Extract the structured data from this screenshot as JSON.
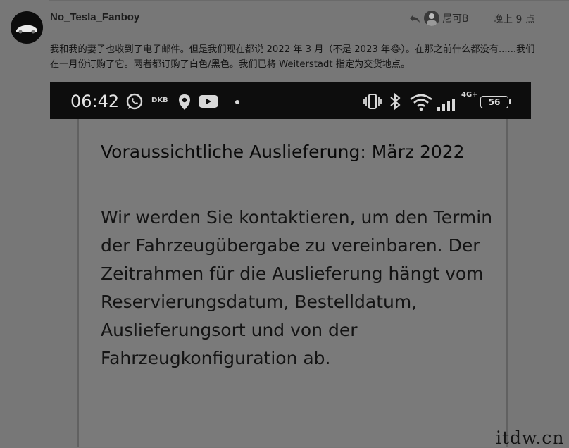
{
  "post": {
    "username": "No_Tesla_Fanboy",
    "reply_to_user": "尼可B",
    "date": "晚上 9 点",
    "text": "我和我的妻子也收到了电子邮件。但是我们现在都说 2022 年 3 月（不是 2023 年😂）。在那之前什么都没有......我们在一月份订购了它。两者都订购了白色/黑色。我们已将 Weiterstadt 指定为交货地点。"
  },
  "phone": {
    "time": "06:42",
    "dkb_label": "DKB",
    "network": "4G+",
    "battery": "56"
  },
  "screenshot": {
    "heading": "Voraussichtliche Auslieferung: März 2022",
    "body": "Wir werden Sie kontaktieren, um den Termin der Fahrzeugübergabe zu vereinbaren. Der Zeitrahmen für die Auslieferung hängt vom Reservierungsdatum, Bestelldatum, Auslieferungsort und von der Fahrzeugkonfiguration ab."
  },
  "watermark": "itdw.cn",
  "colors": {
    "background": "#777777",
    "status_bar": "#0d0d0d"
  }
}
